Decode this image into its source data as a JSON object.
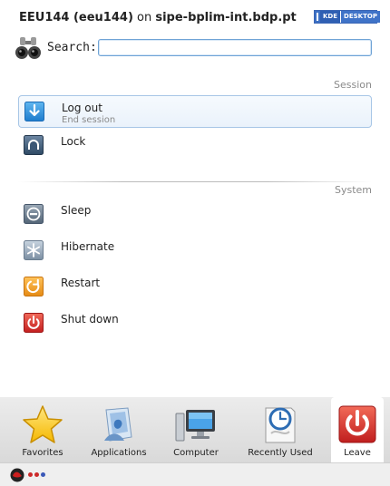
{
  "header": {
    "user": "EEU144 (eeu144)",
    "on": " on ",
    "host": "sipe-bplim-int.bdp.pt",
    "logo_kde": "KDE",
    "logo_desktop": "DESKTOP"
  },
  "search": {
    "label": "Search:",
    "value": "",
    "placeholder": ""
  },
  "sections": {
    "session_title": "Session",
    "system_title": "System"
  },
  "session_items": [
    {
      "label": "Log out",
      "sub": "End session",
      "icon": "logout-icon"
    },
    {
      "label": "Lock",
      "sub": "",
      "icon": "lock-icon"
    }
  ],
  "system_items": [
    {
      "label": "Sleep",
      "icon": "sleep-icon"
    },
    {
      "label": "Hibernate",
      "icon": "hibernate-icon"
    },
    {
      "label": "Restart",
      "icon": "restart-icon"
    },
    {
      "label": "Shut down",
      "icon": "shutdown-icon"
    }
  ],
  "tabs": [
    {
      "label": "Favorites",
      "icon": "star-icon"
    },
    {
      "label": "Applications",
      "icon": "applications-icon"
    },
    {
      "label": "Computer",
      "icon": "computer-icon"
    },
    {
      "label": "Recently Used",
      "icon": "clock-icon"
    },
    {
      "label": "Leave",
      "icon": "power-icon",
      "active": true
    }
  ],
  "colors": {
    "accent": "#6fa3d6",
    "shutdown": "#d83a3a",
    "restart": "#f0a030",
    "logout": "#2f8fdc"
  }
}
